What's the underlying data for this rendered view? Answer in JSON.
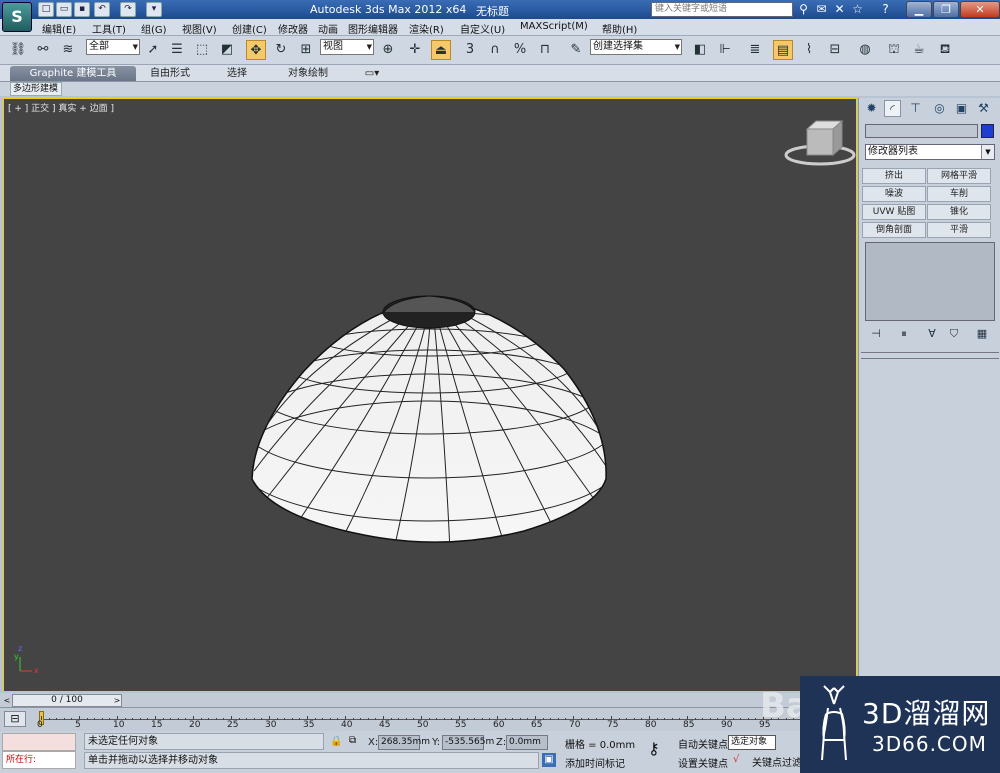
{
  "titlebar": {
    "app_title": "Autodesk 3ds Max  2012 x64",
    "doc_title": "无标题",
    "search_placeholder": "键入关键字或短语",
    "logo_text": "S"
  },
  "menus": [
    "编辑(E)",
    "工具(T)",
    "组(G)",
    "视图(V)",
    "创建(C)",
    "修改器",
    "动画",
    "图形编辑器",
    "渲染(R)",
    "自定义(U)",
    "MAXScript(M)",
    "帮助(H)"
  ],
  "toolbar": {
    "selection_filter": "全部",
    "ref_coord": "视图",
    "named_selection": "创建选择集",
    "snap_label": "3"
  },
  "ribbon": {
    "tabs": [
      "Graphite 建模工具",
      "自由形式",
      "选择",
      "对象绘制"
    ],
    "subtab": "多边形建模"
  },
  "viewport": {
    "label": "[ + ] 正交 ] 真实 + 边面 ]",
    "axis_x": "x",
    "axis_y": "y",
    "axis_z": "z"
  },
  "command_panel": {
    "modifier_list": "修改器列表",
    "modifier_buttons": [
      "挤出",
      "网格平滑",
      "噪波",
      "车削",
      "UVW 贴图",
      "锥化",
      "倒角剖面",
      "平滑"
    ],
    "accent_color": "#1e3ecf"
  },
  "timeline": {
    "frame_counter": "0 / 100",
    "ticks": [
      "0",
      "5",
      "10",
      "15",
      "20",
      "25",
      "30",
      "35",
      "40",
      "45",
      "50",
      "55",
      "60",
      "65",
      "70",
      "75",
      "80",
      "85",
      "90",
      "95"
    ]
  },
  "status": {
    "listener_text": "所在行:",
    "selection_status": "未选定任何对象",
    "prompt": "单击并拖动以选择并移动对象",
    "x_label": "X:",
    "x_value": "268.35mm",
    "y_label": "Y:",
    "y_value": "-535.565m",
    "z_label": "Z:",
    "z_value": "0.0mm",
    "grid": "栅格 = 0.0mm",
    "add_time_tag": "添加时间标记",
    "auto_key": "自动关键点",
    "set_key": "设置关键点",
    "selected": "选定对象",
    "key_filters": "关键点过滤"
  },
  "watermark": {
    "baidu": "Ba",
    "brand_cn": "3D溜溜网",
    "brand_en": "3D66.COM"
  }
}
